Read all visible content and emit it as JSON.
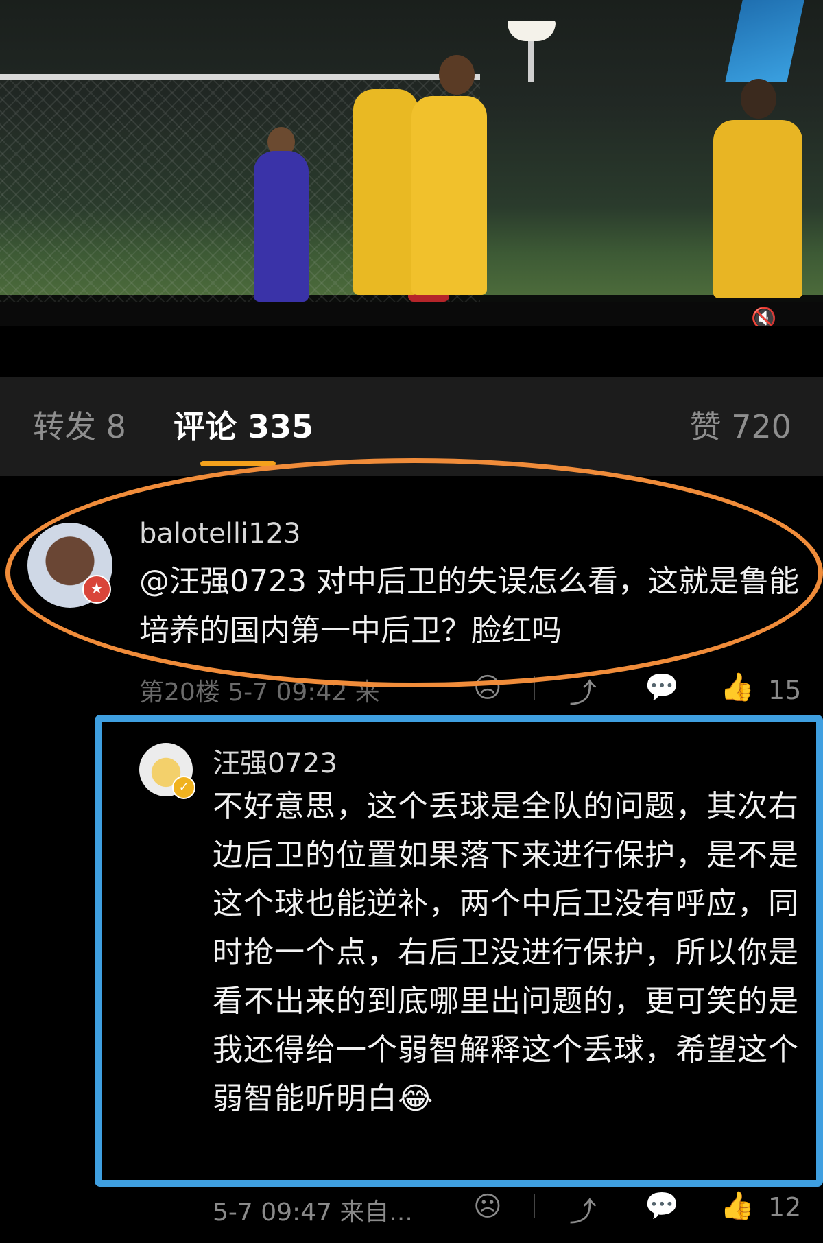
{
  "tabs": {
    "repost": "转发 8",
    "comments": "评论 335",
    "likes": "赞 720"
  },
  "comments": [
    {
      "username": "balotelli123",
      "text": "@汪强0723 对中后卫的失误怎么看，这就是鲁能培养的国内第一中后卫？脸红吗",
      "meta": "第20楼 5-7 09:42 来",
      "like_count": "15"
    },
    {
      "username": "汪强0723",
      "text": "不好意思，这个丢球是全队的问题，其次右边后卫的位置如果落下来进行保护，是不是这个球也能逆补，两个中后卫没有呼应，同时抢一个点，右后卫没进行保护，所以你是看不出来的到底哪里出问题的，更可笑的是我还得给一个弱智解释这个丢球，希望这个弱智能听明白😂",
      "meta": "5-7 09:47 来自...",
      "like_count": "12"
    }
  ],
  "icons": {
    "mute": "speaker-muted-icon",
    "dislike": "sad-face-icon",
    "share": "share-icon",
    "reply": "comment-icon",
    "like": "thumbs-up-icon"
  },
  "colors": {
    "annotation_orange": "#f08c3a",
    "annotation_blue": "#3f9fe0",
    "tab_indicator": "#f4a11c"
  }
}
